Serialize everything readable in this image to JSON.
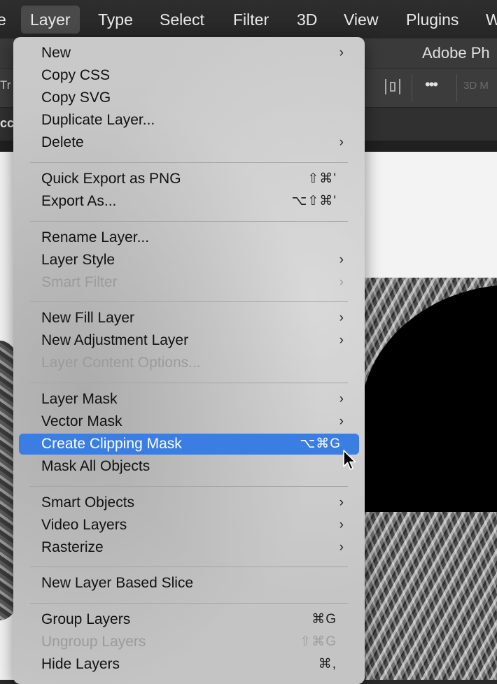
{
  "menubar": {
    "items": [
      {
        "label": "e"
      },
      {
        "label": "Layer"
      },
      {
        "label": "Type"
      },
      {
        "label": "Select"
      },
      {
        "label": "Filter"
      },
      {
        "label": "3D"
      },
      {
        "label": "View"
      },
      {
        "label": "Plugins"
      },
      {
        "label": "W"
      }
    ],
    "active_item": "Layer"
  },
  "app": {
    "title_fragment": "Adobe Ph",
    "options_left_fragment": "Tr",
    "mode_3d_fragment": "3D M",
    "tab_fragment": "cc"
  },
  "icons": {
    "align": "align-icon",
    "more": "more-options-icon",
    "cursor": "mouse-cursor-icon"
  },
  "colors": {
    "highlight": "#3b7ee3",
    "menu_background": "#c6c6c6",
    "disabled_text": "#9b9b9b"
  },
  "menu": {
    "items": [
      {
        "label": "New",
        "shortcut": "",
        "submenu": true,
        "enabled": true
      },
      {
        "label": "Copy CSS",
        "shortcut": "",
        "submenu": false,
        "enabled": true
      },
      {
        "label": "Copy SVG",
        "shortcut": "",
        "submenu": false,
        "enabled": true
      },
      {
        "label": "Duplicate Layer...",
        "shortcut": "",
        "submenu": false,
        "enabled": true
      },
      {
        "label": "Delete",
        "shortcut": "",
        "submenu": true,
        "enabled": true
      },
      {
        "label": "Quick Export as PNG",
        "shortcut": "⇧⌘'",
        "submenu": false,
        "enabled": true
      },
      {
        "label": "Export As...",
        "shortcut": "⌥⇧⌘'",
        "submenu": false,
        "enabled": true
      },
      {
        "label": "Rename Layer...",
        "shortcut": "",
        "submenu": false,
        "enabled": true
      },
      {
        "label": "Layer Style",
        "shortcut": "",
        "submenu": true,
        "enabled": true
      },
      {
        "label": "Smart Filter",
        "shortcut": "",
        "submenu": true,
        "enabled": false
      },
      {
        "label": "New Fill Layer",
        "shortcut": "",
        "submenu": true,
        "enabled": true
      },
      {
        "label": "New Adjustment Layer",
        "shortcut": "",
        "submenu": true,
        "enabled": true
      },
      {
        "label": "Layer Content Options...",
        "shortcut": "",
        "submenu": false,
        "enabled": false
      },
      {
        "label": "Layer Mask",
        "shortcut": "",
        "submenu": true,
        "enabled": true
      },
      {
        "label": "Vector Mask",
        "shortcut": "",
        "submenu": true,
        "enabled": true
      },
      {
        "label": "Create Clipping Mask",
        "shortcut": "⌥⌘G",
        "submenu": false,
        "enabled": true,
        "highlighted": true
      },
      {
        "label": "Mask All Objects",
        "shortcut": "",
        "submenu": false,
        "enabled": true
      },
      {
        "label": "Smart Objects",
        "shortcut": "",
        "submenu": true,
        "enabled": true
      },
      {
        "label": "Video Layers",
        "shortcut": "",
        "submenu": true,
        "enabled": true
      },
      {
        "label": "Rasterize",
        "shortcut": "",
        "submenu": true,
        "enabled": true
      },
      {
        "label": "New Layer Based Slice",
        "shortcut": "",
        "submenu": false,
        "enabled": true
      },
      {
        "label": "Group Layers",
        "shortcut": "⌘G",
        "submenu": false,
        "enabled": true
      },
      {
        "label": "Ungroup Layers",
        "shortcut": "⇧⌘G",
        "submenu": false,
        "enabled": false
      },
      {
        "label": "Hide Layers",
        "shortcut": "⌘,",
        "submenu": false,
        "enabled": true
      }
    ],
    "submenu_arrow": "›"
  }
}
